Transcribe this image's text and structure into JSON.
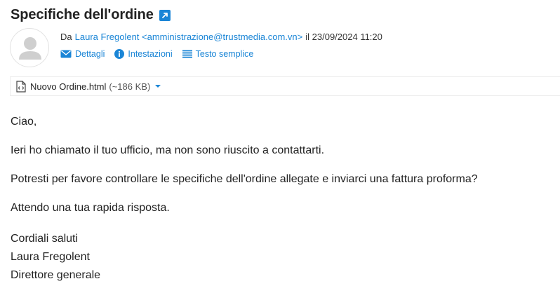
{
  "email": {
    "subject": "Specifiche dell'ordine",
    "from_prefix": "Da",
    "sender": "Laura Fregolent <amministrazione@trustmedia.com.vn>",
    "date": "il 23/09/2024 11:20",
    "links": {
      "details": "Dettagli",
      "headers": "Intestazioni",
      "plain_text": "Testo semplice"
    },
    "attachment": {
      "name": "Nuovo Ordine.html",
      "size": "(~186 KB)"
    },
    "body": {
      "greeting": "Ciao,",
      "p1": "Ieri ho chiamato il tuo ufficio, ma non sono riuscito a contattarti.",
      "p2": "Potresti per favore controllare le specifiche dell'ordine allegate e inviarci una fattura proforma?",
      "p3": "Attendo una tua rapida risposta.",
      "signature": [
        "Cordiali saluti",
        "Laura Fregolent",
        "Direttore generale"
      ]
    }
  },
  "colors": {
    "link": "#1a85d6",
    "text": "#222222",
    "avatar_gray": "#cfcfcf"
  },
  "icons": {
    "popout": "external-link-icon",
    "details": "envelope-icon",
    "headers": "info-icon",
    "plain_text": "list-icon",
    "attachment": "html-file-icon",
    "caret": "chevron-down-icon",
    "avatar": "user-silhouette-icon"
  }
}
